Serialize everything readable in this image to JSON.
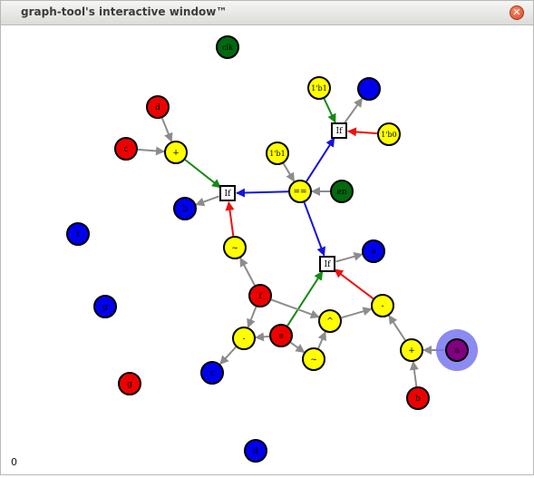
{
  "window": {
    "title": "graph-tool's interactive window™",
    "close_icon": "close-icon",
    "status_text": "0"
  },
  "colors": {
    "red": "#ee0000",
    "blue": "#0000ee",
    "yellow": "#ffff00",
    "green": "#006a10",
    "purple": "#800080",
    "edge_gray": "#8c8c8c",
    "edge_red": "#ee1010",
    "edge_blue": "#1414e0",
    "edge_green": "#168a16",
    "highlight": "#7777ee"
  },
  "graph": {
    "nodes": [
      {
        "id": "clk",
        "label": "clk",
        "color": "green",
        "shape": "circle"
      },
      {
        "id": "b1top",
        "label": "1'b1",
        "color": "yellow",
        "shape": "circle"
      },
      {
        "id": "bl_top",
        "label": "",
        "color": "blue",
        "shape": "circle"
      },
      {
        "id": "d",
        "label": "d",
        "color": "red",
        "shape": "circle"
      },
      {
        "id": "if_top",
        "label": "If",
        "color": "white",
        "shape": "square"
      },
      {
        "id": "b0",
        "label": "1'b0",
        "color": "yellow",
        "shape": "circle"
      },
      {
        "id": "c",
        "label": "c",
        "color": "red",
        "shape": "circle"
      },
      {
        "id": "plus1",
        "label": "+",
        "color": "yellow",
        "shape": "circle"
      },
      {
        "id": "b1mid",
        "label": "1'b1",
        "color": "yellow",
        "shape": "circle"
      },
      {
        "id": "if_left",
        "label": "If",
        "color": "white",
        "shape": "square"
      },
      {
        "id": "eq",
        "label": "==",
        "color": "yellow",
        "shape": "circle"
      },
      {
        "id": "en",
        "label": "en",
        "color": "green",
        "shape": "circle"
      },
      {
        "id": "b_left",
        "label": "b",
        "color": "blue",
        "shape": "circle"
      },
      {
        "id": "lone1",
        "label": "f",
        "color": "blue",
        "shape": "circle"
      },
      {
        "id": "not1",
        "label": "~",
        "color": "yellow",
        "shape": "circle"
      },
      {
        "id": "if_mid",
        "label": "If",
        "color": "white",
        "shape": "square"
      },
      {
        "id": "bl_mid",
        "label": "e",
        "color": "blue",
        "shape": "circle"
      },
      {
        "id": "f_red",
        "label": "f",
        "color": "red",
        "shape": "circle"
      },
      {
        "id": "lone2",
        "label": "g",
        "color": "blue",
        "shape": "circle"
      },
      {
        "id": "minus_r",
        "label": "-",
        "color": "yellow",
        "shape": "circle"
      },
      {
        "id": "xor",
        "label": "^",
        "color": "yellow",
        "shape": "circle"
      },
      {
        "id": "minus_l",
        "label": "-",
        "color": "yellow",
        "shape": "circle"
      },
      {
        "id": "e_red",
        "label": "e",
        "color": "red",
        "shape": "circle"
      },
      {
        "id": "plus2",
        "label": "+",
        "color": "yellow",
        "shape": "circle"
      },
      {
        "id": "a_sel",
        "label": "a",
        "color": "purple",
        "shape": "circle",
        "selected": true
      },
      {
        "id": "not2",
        "label": "~",
        "color": "yellow",
        "shape": "circle"
      },
      {
        "id": "c_blue",
        "label": "c",
        "color": "blue",
        "shape": "circle"
      },
      {
        "id": "g_red",
        "label": "g",
        "color": "red",
        "shape": "circle"
      },
      {
        "id": "b_red",
        "label": "b",
        "color": "red",
        "shape": "circle"
      },
      {
        "id": "d_blue",
        "label": "d",
        "color": "blue",
        "shape": "circle"
      }
    ],
    "edges": [
      {
        "from": "d",
        "to": "plus1",
        "color": "edge_gray"
      },
      {
        "from": "c",
        "to": "plus1",
        "color": "edge_gray"
      },
      {
        "from": "plus1",
        "to": "if_left",
        "color": "edge_green"
      },
      {
        "from": "if_left",
        "to": "b_left",
        "color": "edge_gray"
      },
      {
        "from": "eq",
        "to": "if_left",
        "color": "edge_blue"
      },
      {
        "from": "not1",
        "to": "if_left",
        "color": "edge_red"
      },
      {
        "from": "b1top",
        "to": "if_top",
        "color": "edge_green"
      },
      {
        "from": "if_top",
        "to": "bl_top",
        "color": "edge_gray"
      },
      {
        "from": "b0",
        "to": "if_top",
        "color": "edge_red"
      },
      {
        "from": "eq",
        "to": "if_top",
        "color": "edge_blue"
      },
      {
        "from": "b1mid",
        "to": "eq",
        "color": "edge_gray"
      },
      {
        "from": "en",
        "to": "eq",
        "color": "edge_gray"
      },
      {
        "from": "eq",
        "to": "if_mid",
        "color": "edge_blue"
      },
      {
        "from": "if_mid",
        "to": "bl_mid",
        "color": "edge_gray"
      },
      {
        "from": "minus_r",
        "to": "if_mid",
        "color": "edge_red"
      },
      {
        "from": "e_red",
        "to": "if_mid",
        "color": "edge_green"
      },
      {
        "from": "f_red",
        "to": "not1",
        "color": "edge_gray"
      },
      {
        "from": "f_red",
        "to": "xor",
        "color": "edge_gray"
      },
      {
        "from": "f_red",
        "to": "minus_l",
        "color": "edge_gray"
      },
      {
        "from": "xor",
        "to": "minus_r",
        "color": "edge_gray"
      },
      {
        "from": "e_red",
        "to": "minus_l",
        "color": "edge_gray"
      },
      {
        "from": "e_red",
        "to": "not2",
        "color": "edge_gray"
      },
      {
        "from": "not2",
        "to": "xor",
        "color": "edge_gray"
      },
      {
        "from": "minus_l",
        "to": "c_blue",
        "color": "edge_gray"
      },
      {
        "from": "plus2",
        "to": "minus_r",
        "color": "edge_gray"
      },
      {
        "from": "a_sel",
        "to": "plus2",
        "color": "edge_gray"
      },
      {
        "from": "b_red",
        "to": "plus2",
        "color": "edge_gray"
      }
    ]
  }
}
